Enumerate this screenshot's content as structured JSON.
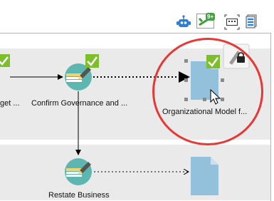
{
  "toolbar": {
    "badge_count": "9+"
  },
  "diagram": {
    "nodes": {
      "budget_task_label": "get ...",
      "confirm_governance_label": "Confirm Governance and ...",
      "org_model_label": "Organizational Model f...",
      "restate_business_label": "Restate Business"
    }
  },
  "colors": {
    "task_circle": "#5db6b0",
    "document": "#93c0db",
    "check_green": "#7cbf2b",
    "highlight_ring": "#e53935",
    "lane_bg": "#eaeaea"
  }
}
